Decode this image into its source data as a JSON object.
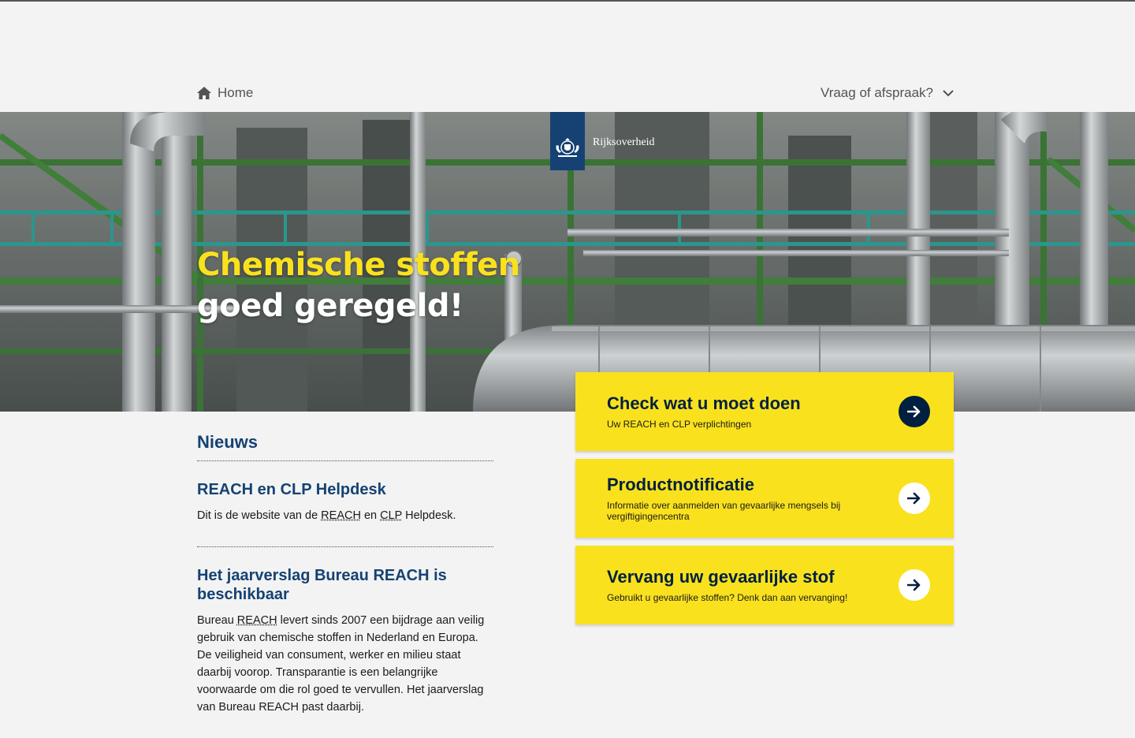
{
  "topnav": {
    "home_label": "Home",
    "question_label": "Vraag of afspraak?"
  },
  "logo": {
    "wordmark": "Rijksoverheid"
  },
  "hero": {
    "title_line1": "Chemische stoffen",
    "title_line2": "goed geregeld!"
  },
  "news": {
    "heading": "Nieuws",
    "items": [
      {
        "title": "REACH en CLP Helpdesk",
        "text_before": "Dit is de website van de ",
        "abbr1": "REACH",
        "text_mid": " en ",
        "abbr2": "CLP",
        "text_after": " Helpdesk."
      },
      {
        "title": "Het jaarverslag Bureau REACH is beschikbaar",
        "text_before": "Bureau ",
        "abbr1": "REACH",
        "text_after": " levert sinds 2007 een bijdrage aan veilig gebruik van chemische stoffen in Nederland en Europa. De veiligheid van consument, werker en milieu staat daarbij voorop. Transparantie is een belangrijke voorwaarde om die rol goed te vervullen. Het jaarverslag van Bureau REACH past daarbij."
      }
    ]
  },
  "cards": [
    {
      "title": "Check wat u moet doen",
      "subtitle": "Uw REACH en CLP verplichtingen",
      "icon": "arrow-right-icon"
    },
    {
      "title": "Productnotificatie",
      "subtitle": "Informatie over aanmelden van gevaarlijke mengsels bij vergiftigingencentra",
      "icon": "arrow-right-icon"
    },
    {
      "title": "Vervang uw gevaarlijke stof",
      "subtitle": "Gebruikt u gevaarlijke stoffen? Denk dan aan vervanging!",
      "icon": "arrow-right-icon"
    }
  ],
  "colors": {
    "background": "#f3f3f3",
    "brand_blue": "#154273",
    "accent_yellow": "#f9e11e",
    "dark_navy": "#01203f"
  }
}
